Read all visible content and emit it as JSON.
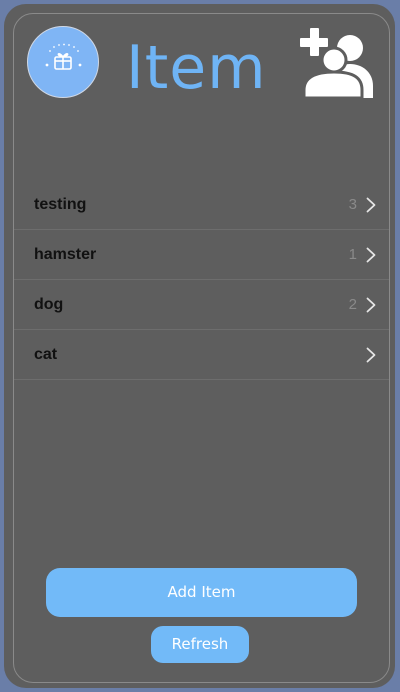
{
  "header": {
    "title": "Item",
    "logo_icon": "gift-box-logo-icon",
    "add_icon": "add-user-icon"
  },
  "items": [
    {
      "name": "testing",
      "count": "3"
    },
    {
      "name": "hamster",
      "count": "1"
    },
    {
      "name": "dog",
      "count": "2"
    },
    {
      "name": "cat",
      "count": ""
    }
  ],
  "actions": {
    "add_label": "Add Item",
    "refresh_label": "Refresh"
  },
  "colors": {
    "accent": "#72baf8",
    "title": "#6fb4f5",
    "panel": "#5e5e5e",
    "background": "#6a7ea8"
  }
}
